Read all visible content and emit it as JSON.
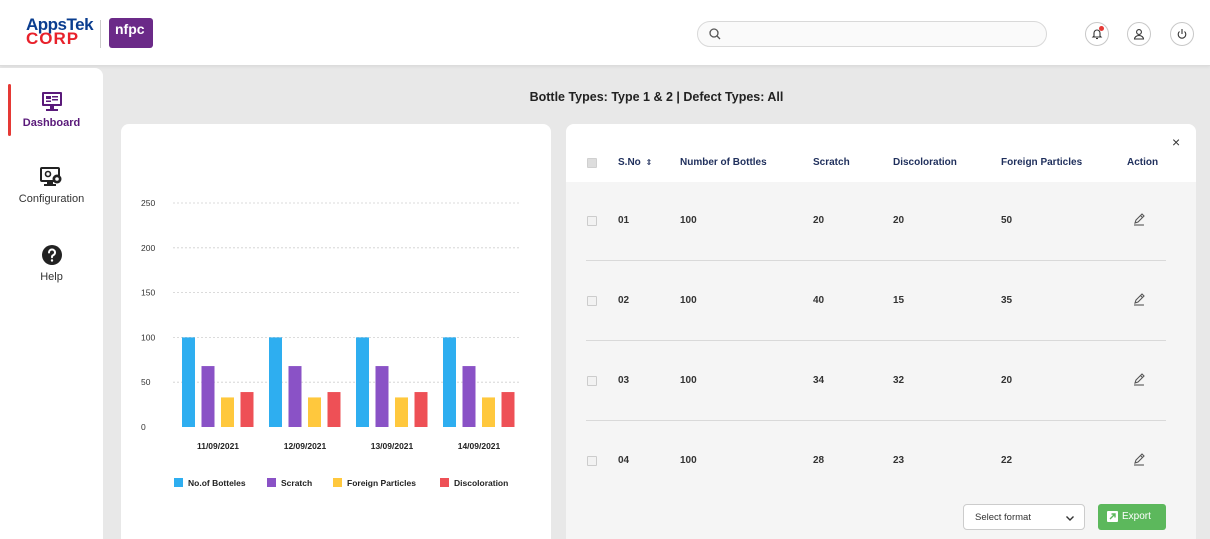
{
  "header": {
    "logo_line1": "AppsTek",
    "logo_line2": "CORP",
    "client_logo": "nfpc",
    "search": {
      "placeholder": "",
      "value": ""
    },
    "icons": [
      "notification-bell-icon",
      "user-icon",
      "power-icon"
    ]
  },
  "sidebar": {
    "items": [
      {
        "label": "Dashboard",
        "icon": "dashboard-monitor-icon",
        "active": true
      },
      {
        "label": "Configuration",
        "icon": "config-monitor-icon",
        "active": false
      },
      {
        "label": "Help",
        "icon": "help-icon",
        "active": false
      }
    ]
  },
  "page_title": "Bottle Types: Type 1 & 2 | Defect Types: All",
  "chart_data": {
    "type": "bar",
    "categories": [
      "11/09/2021",
      "12/09/2021",
      "13/09/2021",
      "14/09/2021"
    ],
    "series": [
      {
        "name": "No.of Botteles",
        "color": "#2eaef0",
        "values": [
          100,
          100,
          100,
          100
        ]
      },
      {
        "name": "Scratch",
        "color": "#8a52c6",
        "values": [
          68,
          68,
          68,
          68
        ]
      },
      {
        "name": "Foreign Particles",
        "color": "#ffc83d",
        "values": [
          33,
          33,
          33,
          33
        ]
      },
      {
        "name": "Discoloration",
        "color": "#ee5056",
        "values": [
          39,
          39,
          39,
          39
        ]
      }
    ],
    "yticks": [
      "0",
      "50",
      "100",
      "150",
      "200",
      "250"
    ],
    "ylim": [
      0,
      250
    ],
    "title": "",
    "xlabel": "",
    "ylabel": "",
    "grid": true,
    "legend": "bottom"
  },
  "table": {
    "columns": [
      "S.No",
      "Number of Bottles",
      "Scratch",
      "Discoloration",
      "Foreign Particles",
      "Action"
    ],
    "sort_indicator": "⇕",
    "rows": [
      {
        "sno": "01",
        "bottles": "100",
        "scratch": "20",
        "discoloration": "20",
        "foreign": "50"
      },
      {
        "sno": "02",
        "bottles": "100",
        "scratch": "40",
        "discoloration": "15",
        "foreign": "35"
      },
      {
        "sno": "03",
        "bottles": "100",
        "scratch": "34",
        "discoloration": "32",
        "foreign": "20"
      },
      {
        "sno": "04",
        "bottles": "100",
        "scratch": "28",
        "discoloration": "23",
        "foreign": "22"
      }
    ],
    "close_label": "×",
    "select_format_label": "Select format",
    "export_label": "Export"
  }
}
